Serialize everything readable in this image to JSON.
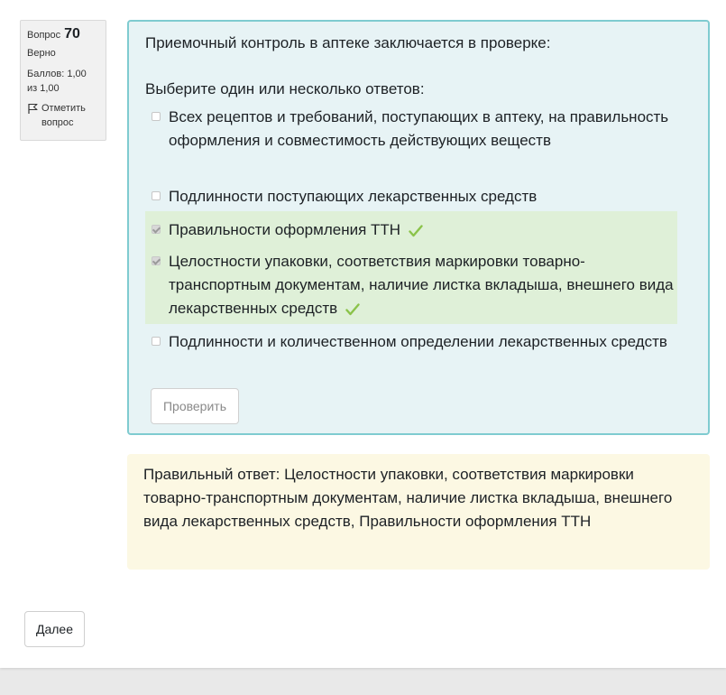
{
  "info": {
    "question_label": "Вопрос",
    "question_number": "70",
    "state": "Верно",
    "grade": "Баллов: 1,00 из 1,00",
    "flag_label": "Отметить вопрос",
    "flag_icon": "flag-icon"
  },
  "question": {
    "text": "Приемочный контроль в аптеке заключается в проверке:",
    "prompt": "Выберите один или несколько ответов:",
    "options": [
      {
        "label": "Всех рецептов и требований, поступающих в аптеку, на правильность оформления и совместимость действующих веществ",
        "checked": false,
        "correct": false
      },
      {
        "label": "Подлинности поступающих лекарственных средств",
        "checked": false,
        "correct": false
      },
      {
        "label": "Правильности оформления ТТН",
        "checked": true,
        "correct": true
      },
      {
        "label": "Целостности упаковки, соответствия маркировки товарно-транспортным документам, наличие листка вкладыша, внешнего вида лекарственных средств",
        "checked": true,
        "correct": true
      },
      {
        "label": "Подлинности и количественном определении лекарственных средств",
        "checked": false,
        "correct": false
      }
    ],
    "check_button": "Проверить"
  },
  "feedback": {
    "text": "Правильный ответ: Целостности упаковки, соответствия маркировки товарно-транспортным документам, наличие листка вкладыша, внешнего вида лекарственных средств, Правильности оформления ТТН"
  },
  "navigation": {
    "next_button": "Далее"
  },
  "colors": {
    "question_bg": "#e7f3f5",
    "question_border": "#7fcbd0",
    "correct_bg": "#dff0d8",
    "feedback_bg": "#fcf8e3",
    "tick": "#8bc34a"
  }
}
